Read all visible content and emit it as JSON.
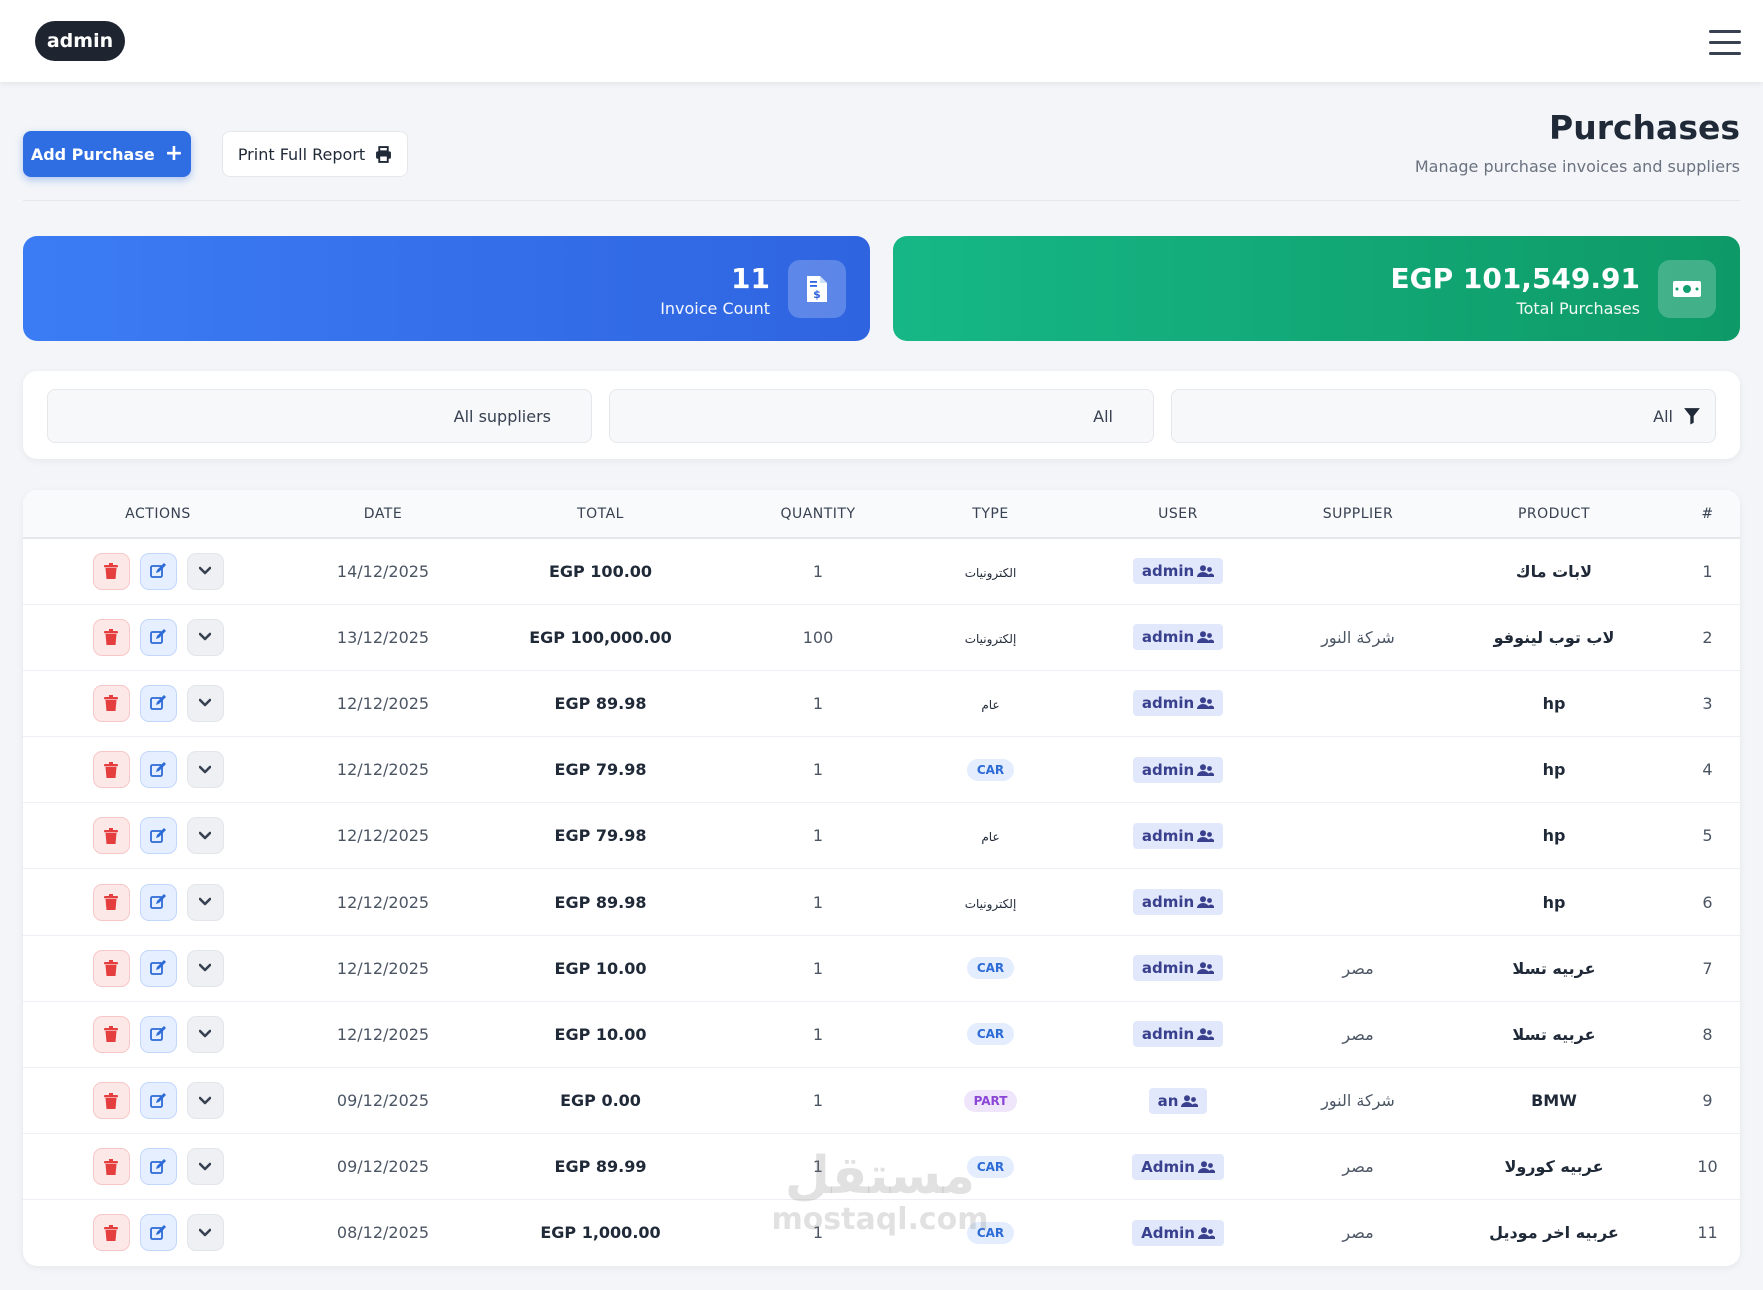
{
  "topbar": {
    "user": "admin"
  },
  "header": {
    "add_label": "Add Purchase",
    "print_label": "Print Full Report",
    "title": "Purchases",
    "subtitle": "Manage purchase invoices and suppliers"
  },
  "stats": {
    "invoice_count": "11",
    "invoice_label": "Invoice Count",
    "total_value": "EGP 101,549.91",
    "total_label": "Total Purchases",
    "colors": {
      "blue": "#2f6de3",
      "green": "#10a06f"
    }
  },
  "filters": {
    "supplier": "All suppliers",
    "middle": "All",
    "type": "All"
  },
  "table": {
    "headers": [
      "ACTIONS",
      "DATE",
      "TOTAL",
      "QUANTITY",
      "TYPE",
      "USER",
      "SUPPLIER",
      "PRODUCT",
      "#"
    ],
    "rows": [
      {
        "date": "14/12/2025",
        "total": "EGP 100.00",
        "quantity": "1",
        "type": "الكترونيات",
        "type_style": "plain",
        "user": "admin",
        "supplier": "",
        "product": "لابات ماك",
        "num": "1"
      },
      {
        "date": "13/12/2025",
        "total": "EGP 100,000.00",
        "quantity": "100",
        "type": "إلكترونيات",
        "type_style": "plain",
        "user": "admin",
        "supplier": "شركة النور",
        "product": "لاب توب لينوفو",
        "num": "2"
      },
      {
        "date": "12/12/2025",
        "total": "EGP 89.98",
        "quantity": "1",
        "type": "عام",
        "type_style": "plain",
        "user": "admin",
        "supplier": "",
        "product": "hp",
        "num": "3"
      },
      {
        "date": "12/12/2025",
        "total": "EGP 79.98",
        "quantity": "1",
        "type": "CAR",
        "type_style": "car",
        "user": "admin",
        "supplier": "",
        "product": "hp",
        "num": "4"
      },
      {
        "date": "12/12/2025",
        "total": "EGP 79.98",
        "quantity": "1",
        "type": "عام",
        "type_style": "plain",
        "user": "admin",
        "supplier": "",
        "product": "hp",
        "num": "5"
      },
      {
        "date": "12/12/2025",
        "total": "EGP 89.98",
        "quantity": "1",
        "type": "إلكترونيات",
        "type_style": "plain",
        "user": "admin",
        "supplier": "",
        "product": "hp",
        "num": "6"
      },
      {
        "date": "12/12/2025",
        "total": "EGP 10.00",
        "quantity": "1",
        "type": "CAR",
        "type_style": "car",
        "user": "admin",
        "supplier": "مصر",
        "product": "عربيه تسلا",
        "num": "7"
      },
      {
        "date": "12/12/2025",
        "total": "EGP 10.00",
        "quantity": "1",
        "type": "CAR",
        "type_style": "car",
        "user": "admin",
        "supplier": "مصر",
        "product": "عربيه تسلا",
        "num": "8"
      },
      {
        "date": "09/12/2025",
        "total": "EGP 0.00",
        "quantity": "1",
        "type": "PART",
        "type_style": "part",
        "user": "an",
        "supplier": "شركة النور",
        "product": "BMW",
        "num": "9"
      },
      {
        "date": "09/12/2025",
        "total": "EGP 89.99",
        "quantity": "1",
        "type": "CAR",
        "type_style": "car",
        "user": "Admin",
        "supplier": "مصر",
        "product": "عربيه كورولا",
        "num": "10"
      },
      {
        "date": "08/12/2025",
        "total": "EGP 1,000.00",
        "quantity": "1",
        "type": "CAR",
        "type_style": "car",
        "user": "Admin",
        "supplier": "مصر",
        "product": "عربيه اخر موديل",
        "num": "11"
      }
    ]
  },
  "watermark": {
    "arabic": "مستقل",
    "latin": "mostaql.com"
  }
}
